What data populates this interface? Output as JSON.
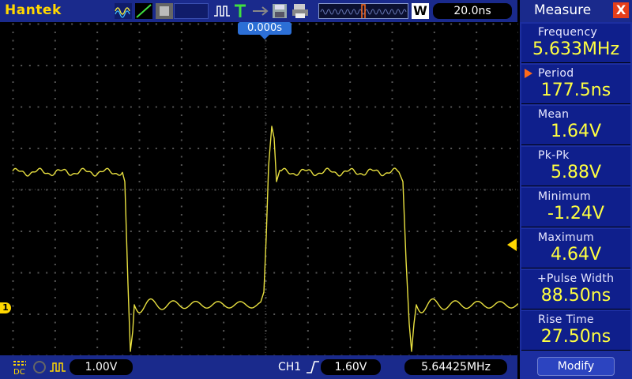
{
  "header": {
    "brand": "Hantek",
    "wave_icon": "sine-wave-icon",
    "timebase": "20.0ns",
    "memory_mode": "W"
  },
  "scope": {
    "trigger_time": "0.000s",
    "channel_marker": "1"
  },
  "bottom": {
    "coupling": "DC",
    "ch1_volts_div": "1.00V",
    "trigger_source": "CH1",
    "trigger_level": "1.60V",
    "frequency_readout": "5.64425MHz"
  },
  "panel": {
    "title": "Measure",
    "close_label": "X",
    "measurements": [
      {
        "label": "Frequency",
        "value": "5.633MHz"
      },
      {
        "label": "Period",
        "value": "177.5ns"
      },
      {
        "label": "Mean",
        "value": "1.64V"
      },
      {
        "label": "Pk-Pk",
        "value": "5.88V"
      },
      {
        "label": "Minimum",
        "value": "-1.24V"
      },
      {
        "label": "Maximum",
        "value": "4.64V"
      },
      {
        "label": "+Pulse Width",
        "value": "88.50ns"
      },
      {
        "label": "Rise Time",
        "value": "27.50ns"
      }
    ],
    "modify_label": "Modify"
  },
  "colors": {
    "trace": "#e8e040",
    "toolbar": "#1a2a8c",
    "panel": "#1c2ea0",
    "value": "#ffff40"
  }
}
